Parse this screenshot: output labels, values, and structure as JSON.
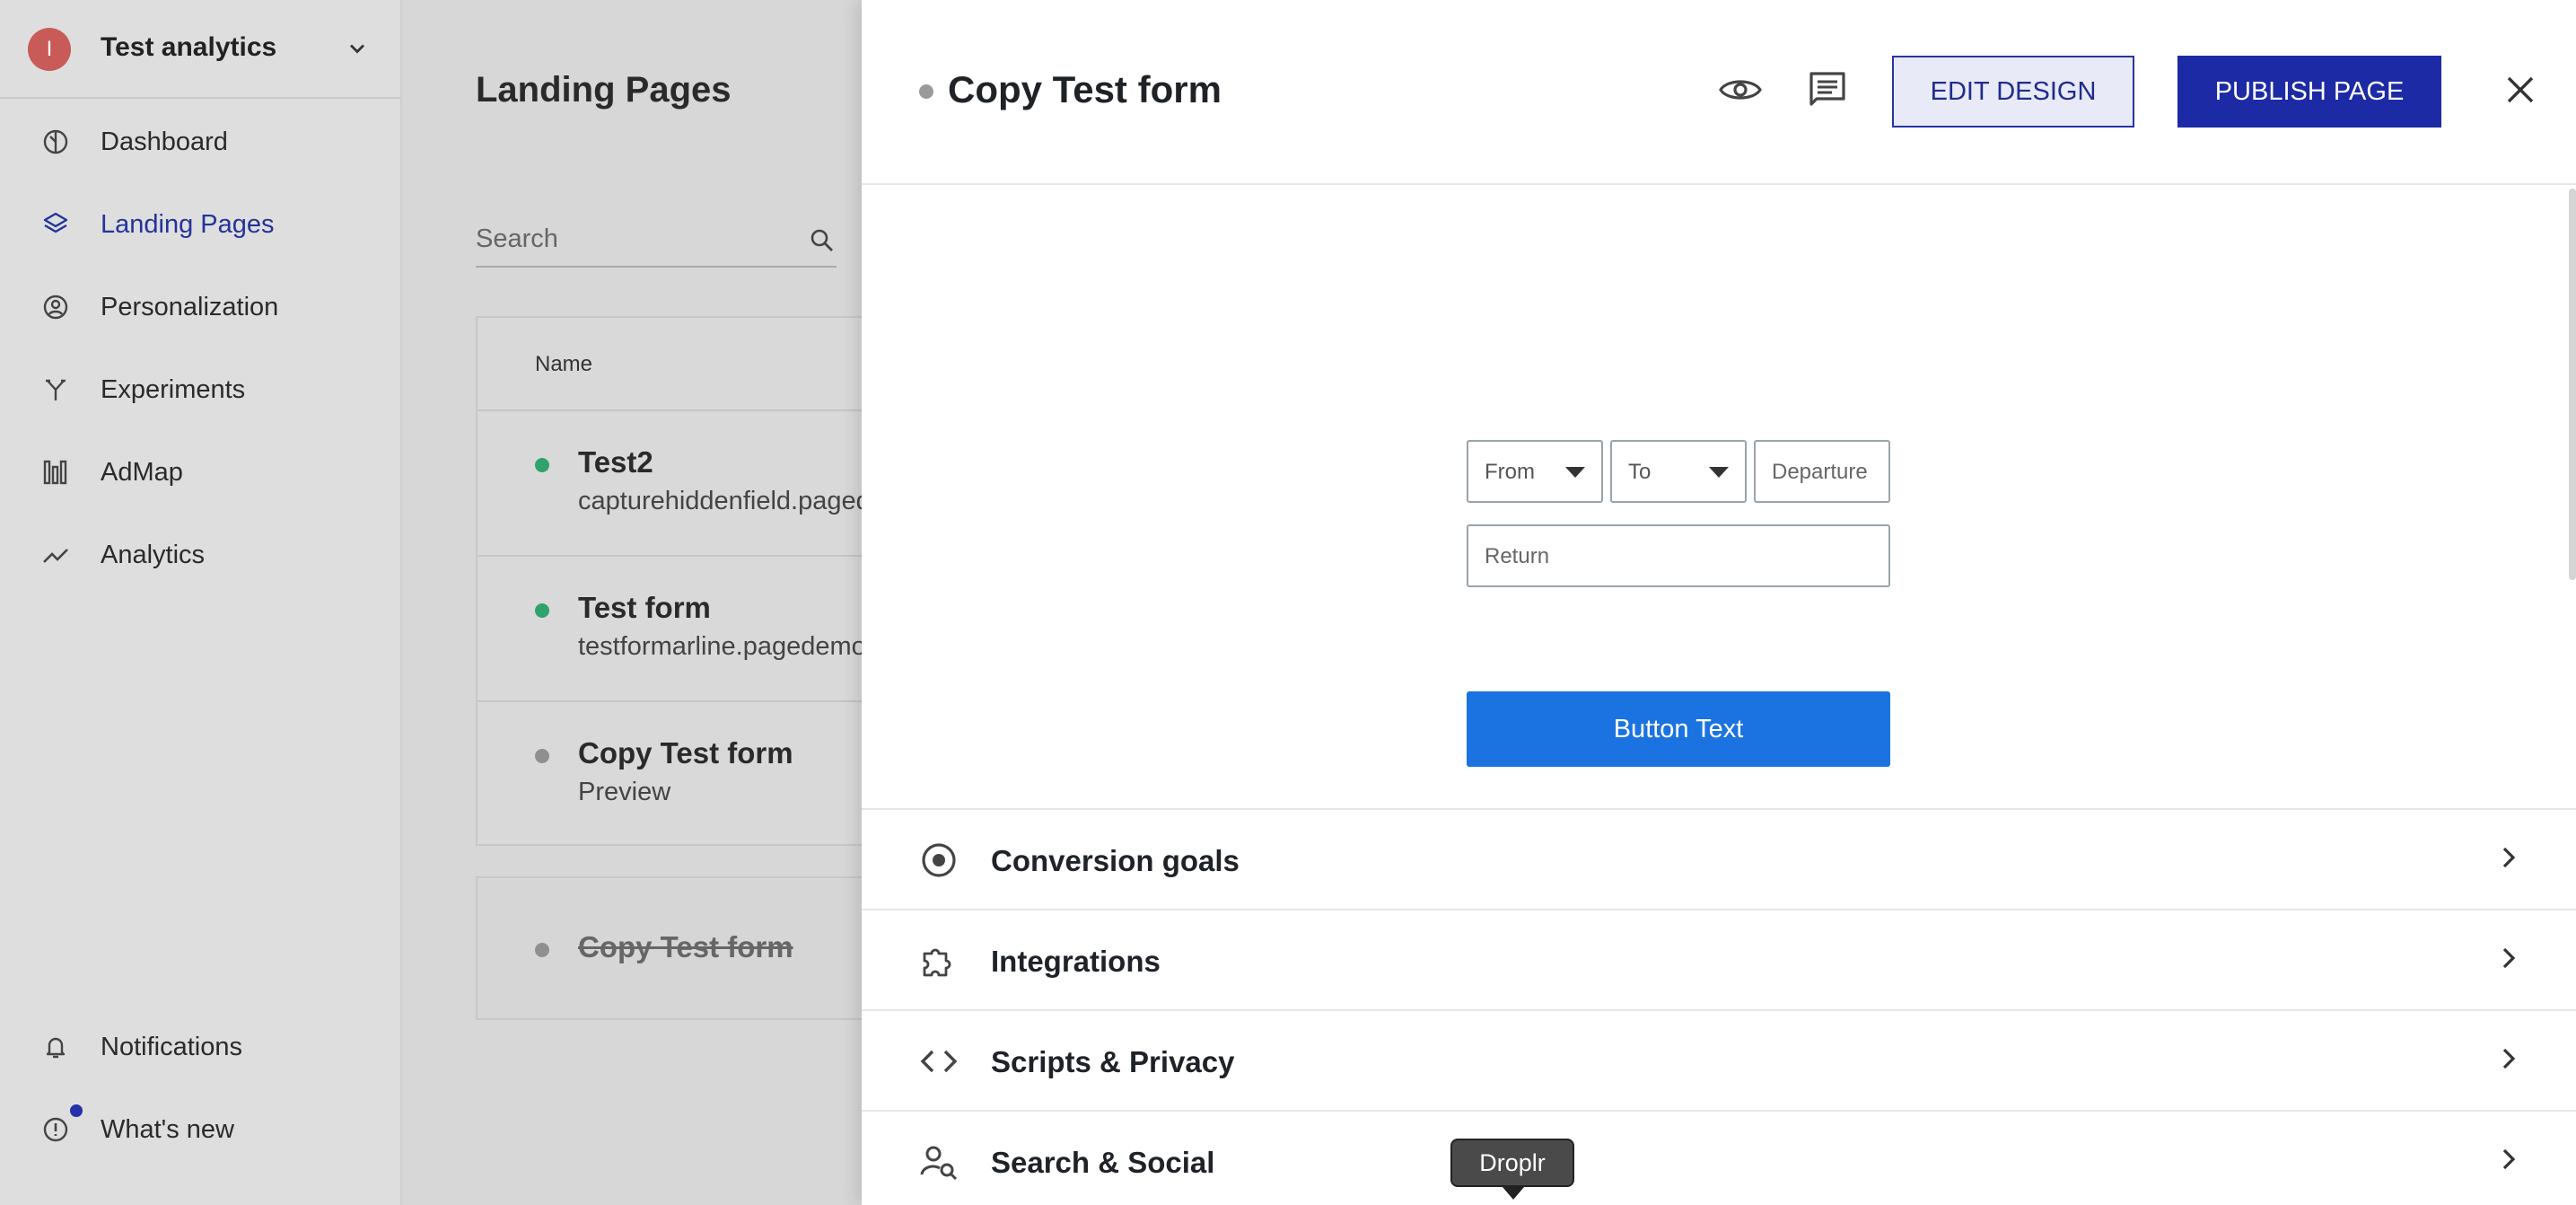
{
  "workspace": {
    "initial": "I",
    "name": "Test analytics"
  },
  "nav": {
    "dashboard": "Dashboard",
    "landing_pages": "Landing Pages",
    "personalization": "Personalization",
    "experiments": "Experiments",
    "admap": "AdMap",
    "analytics": "Analytics",
    "notifications": "Notifications",
    "whats_new": "What's new"
  },
  "list": {
    "title": "Landing Pages",
    "search_placeholder": "Search",
    "column_name": "Name",
    "rows": [
      {
        "title": "Test2",
        "subtitle": "capturehiddenfield.pagedemo",
        "status_color": "#2fa36b"
      },
      {
        "title": "Test form",
        "subtitle": "testformarline.pagedemo",
        "status_color": "#2fa36b"
      },
      {
        "title": "Copy Test form",
        "subtitle": "Preview",
        "status_color": "#8f8f8f"
      }
    ],
    "archived": {
      "title": "Copy Test form"
    }
  },
  "panel": {
    "title": "Copy Test form",
    "edit_design": "EDIT DESIGN",
    "publish_page": "PUBLISH PAGE",
    "form": {
      "from": "From",
      "to": "To",
      "departure": "Departure",
      "return": "Return",
      "button": "Button Text"
    },
    "sections": {
      "conversion_goals": "Conversion goals",
      "integrations": "Integrations",
      "scripts_privacy": "Scripts & Privacy",
      "search_social": "Search & Social"
    }
  },
  "tooltip": "Droplr",
  "colors": {
    "accent": "#1c2aa6",
    "cta": "#1a73e0",
    "avatar": "#c85a57",
    "active_dot": "#2fa36b"
  }
}
